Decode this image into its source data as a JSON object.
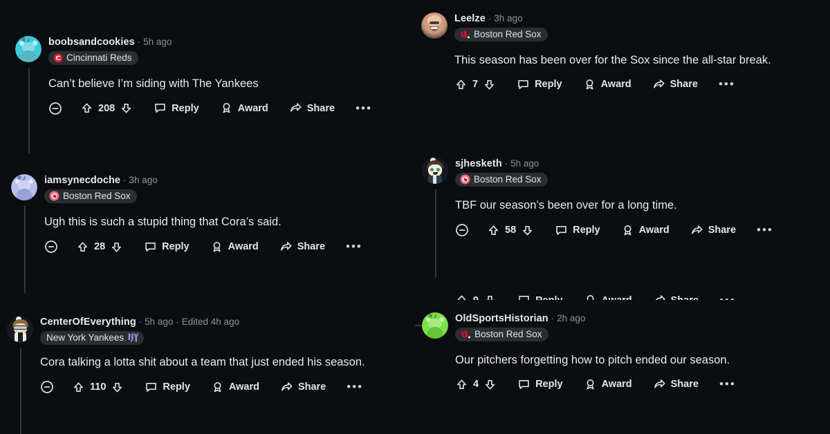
{
  "theme": {
    "background": "#0b0e11",
    "text_primary": "#e9ecee",
    "text_muted": "#8c9296",
    "flair_bg": "#2a2d31",
    "thread_line": "#33383d"
  },
  "labels": {
    "reply": "Reply",
    "award": "Award",
    "share": "Share",
    "more": "•••",
    "separator": "·"
  },
  "left_column": {
    "comments": [
      {
        "username": "boobsandcookies",
        "timestamp": "5h ago",
        "edited": "",
        "flair": {
          "text": "Cincinnati Reds",
          "icon": "cincinnati-reds-logo",
          "icon_side": "left"
        },
        "text": "Can’t believe I’m siding with The Yankees",
        "votes": "208",
        "has_collapse": true,
        "avatar": {
          "type": "snoo",
          "color": "#3fc9dd",
          "name": "avatar-boobsandcookies"
        }
      },
      {
        "username": "iamsynecdoche",
        "timestamp": "3h ago",
        "edited": "",
        "flair": {
          "text": "Boston Red Sox",
          "icon": "red-sox-circle-logo",
          "icon_side": "left"
        },
        "text": "Ugh this is such a stupid thing that Cora’s said.",
        "votes": "28",
        "has_collapse": true,
        "avatar": {
          "type": "snoo",
          "color": "#9aa7e0",
          "name": "avatar-iamsynecdoche"
        }
      },
      {
        "username": "CenterOfEverything",
        "timestamp": "5h ago",
        "edited": "Edited 4h ago",
        "flair": {
          "text": "New York Yankees",
          "icon": "yankees-ny-logo",
          "icon_side": "right"
        },
        "text": "Cora talking a lotta shit about a team that just ended his season.",
        "votes": "110",
        "has_collapse": true,
        "avatar": {
          "type": "custom-suit",
          "color": "#1f2226",
          "name": "avatar-centerofeverything"
        }
      }
    ]
  },
  "right_column": {
    "comments": [
      {
        "username": "Leelze",
        "timestamp": "3h ago",
        "edited": "",
        "flair": {
          "text": "Boston Red Sox",
          "icon": "red-sox-socks-logo",
          "icon_side": "left"
        },
        "text": "This season has been over for the Sox since the all-star break.",
        "votes": "7",
        "has_collapse": false,
        "avatar": {
          "type": "photo",
          "color": "#c9a489",
          "name": "avatar-leelze"
        }
      },
      {
        "username": "sjhesketh",
        "timestamp": "5h ago",
        "edited": "",
        "flair": {
          "text": "Boston Red Sox",
          "icon": "red-sox-circle-logo",
          "icon_side": "left"
        },
        "text": "TBF our season’s been over for a long time.",
        "votes": "58",
        "has_collapse": true,
        "avatar": {
          "type": "custom-suit",
          "color": "#1f2226",
          "name": "avatar-sjhesketh"
        }
      },
      {
        "username": "OldSportsHistorian",
        "timestamp": "2h ago",
        "edited": "",
        "flair": {
          "text": "Boston Red Sox",
          "icon": "red-sox-socks-logo",
          "icon_side": "left"
        },
        "text": "Our pitchers forgetting how to pitch ended our season.",
        "votes": "4",
        "has_collapse": false,
        "avatar": {
          "type": "snoo",
          "color": "#7ee04f",
          "name": "avatar-oldsportshistorian"
        }
      }
    ],
    "clipped_row_above_last": true
  }
}
